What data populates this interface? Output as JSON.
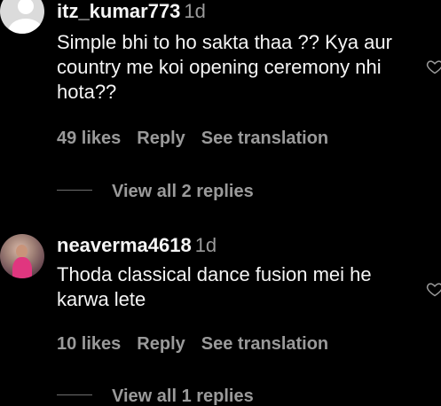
{
  "comments": [
    {
      "username": "itz_kumar773",
      "time": "1d",
      "text": "Simple bhi to ho sakta thaa ?? Kya aur country me koi opening ceremony nhi hota??",
      "likes": "49 likes",
      "reply_label": "Reply",
      "translate_label": "See translation",
      "view_replies": "View all 2 replies",
      "avatar_icon": "default-avatar-icon",
      "like_icon": "heart-outline-icon"
    },
    {
      "username": "neaverma4618",
      "time": "1d",
      "text": "Thoda classical dance fusion mei he karwa lete",
      "likes": "10 likes",
      "reply_label": "Reply",
      "translate_label": "See translation",
      "view_replies": "View all 1 replies",
      "avatar_icon": "user-photo-avatar",
      "like_icon": "heart-outline-icon"
    }
  ],
  "colors": {
    "background": "#000000",
    "primary_text": "#f5f5f5",
    "secondary_text": "#9a9a9a"
  }
}
